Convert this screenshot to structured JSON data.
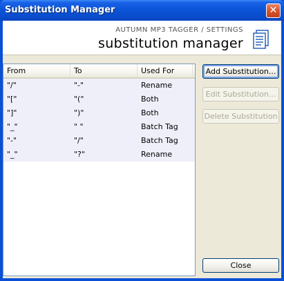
{
  "window": {
    "title": "Substitution Manager",
    "close_glyph": "✕"
  },
  "header": {
    "subtitle": "AUTUMN MP3 TAGGER / SETTINGS",
    "heading": "substitution manager",
    "icon": "document-list-icon"
  },
  "table": {
    "columns": [
      "From",
      "To",
      "Used For"
    ],
    "rows": [
      {
        "from": "\"/\"",
        "to": "\"-\"",
        "used_for": "Rename"
      },
      {
        "from": "\"[\"",
        "to": "\"(\"",
        "used_for": "Both"
      },
      {
        "from": "\"]\"",
        "to": "\")\"",
        "used_for": "Both"
      },
      {
        "from": "\"_\"",
        "to": "\" \"",
        "used_for": "Batch Tag"
      },
      {
        "from": "\"-\"",
        "to": "\"/\"",
        "used_for": "Batch Tag"
      },
      {
        "from": "\"_\"",
        "to": "\"?\"",
        "used_for": "Rename"
      }
    ]
  },
  "buttons": {
    "add": "Add Substitution...",
    "edit": "Edit Substitution...",
    "delete": "Delete Substitution",
    "close": "Close"
  },
  "colors": {
    "title_bar": "#0a4fd6",
    "window_bg": "#ece9d8",
    "row_alt": "#efeffa"
  }
}
